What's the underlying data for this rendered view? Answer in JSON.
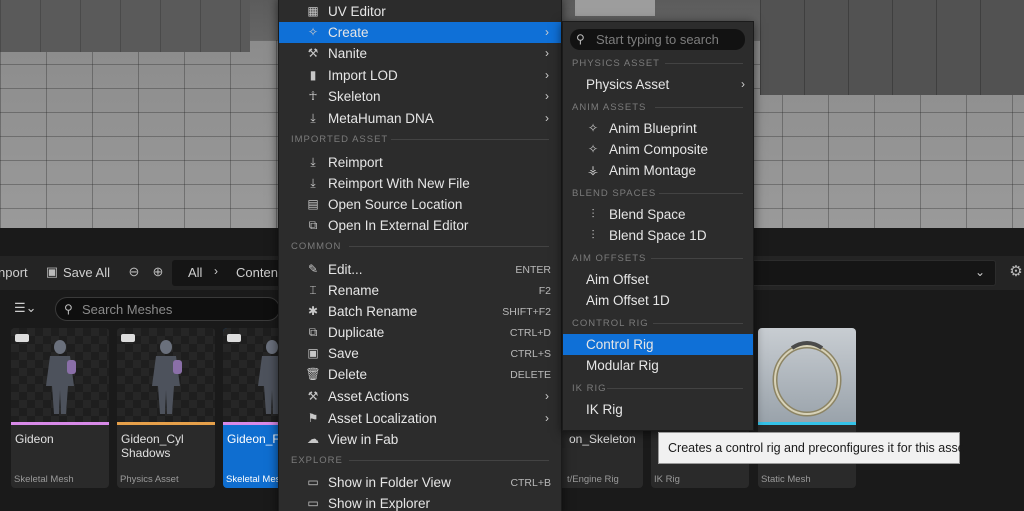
{
  "toolbar": {
    "import_label": "nport",
    "save_all_label": "Save All",
    "path_all": "All",
    "path_content": "Conten"
  },
  "content_browser": {
    "search_placeholder": "Search Meshes",
    "assets": [
      {
        "name": "Gideon",
        "type": "Skeletal Mesh",
        "color": "#d88ae8"
      },
      {
        "name": "Gideon_Cyl Shadows",
        "type": "Physics Asset",
        "color": "#e6a04a"
      },
      {
        "name": "Gideon_Fi",
        "type": "Skeletal Mes",
        "color": "#d88ae8"
      },
      {
        "name": "on_Skeleton",
        "type": "t/Engine Rig",
        "color": ""
      },
      {
        "name": "",
        "type": "IK Rig",
        "color": ""
      },
      {
        "name": "",
        "type": "Static Mesh",
        "color": "#35c2e8"
      }
    ]
  },
  "context_menu": {
    "items": [
      {
        "label": "UV Editor",
        "icon": "uv-editor-icon",
        "shortcut": "",
        "submenu": false
      },
      {
        "label": "Create",
        "icon": "create-icon",
        "shortcut": "",
        "submenu": true
      },
      {
        "label": "Nanite",
        "icon": "wrench-icon",
        "shortcut": "",
        "submenu": true
      },
      {
        "label": "Import LOD",
        "icon": "lod-icon",
        "shortcut": "",
        "submenu": true
      },
      {
        "label": "Skeleton",
        "icon": "skeleton-icon",
        "shortcut": "",
        "submenu": true
      },
      {
        "label": "MetaHuman DNA",
        "icon": "import-icon",
        "shortcut": "",
        "submenu": true
      }
    ],
    "section_imported": "IMPORTED ASSET",
    "imported_items": [
      {
        "label": "Reimport",
        "icon": "reimport-icon"
      },
      {
        "label": "Reimport With New File",
        "icon": "reimport-file-icon"
      },
      {
        "label": "Open Source Location",
        "icon": "folder-open-icon"
      },
      {
        "label": "Open In External Editor",
        "icon": "external-editor-icon"
      }
    ],
    "section_common": "COMMON",
    "common_items": [
      {
        "label": "Edit...",
        "icon": "pencil-icon",
        "shortcut": "ENTER",
        "submenu": false
      },
      {
        "label": "Rename",
        "icon": "rename-icon",
        "shortcut": "F2",
        "submenu": false
      },
      {
        "label": "Batch Rename",
        "icon": "batch-rename-icon",
        "shortcut": "SHIFT+F2",
        "submenu": false
      },
      {
        "label": "Duplicate",
        "icon": "duplicate-icon",
        "shortcut": "CTRL+D",
        "submenu": false
      },
      {
        "label": "Save",
        "icon": "save-icon",
        "shortcut": "CTRL+S",
        "submenu": false
      },
      {
        "label": "Delete",
        "icon": "trash-icon",
        "shortcut": "DELETE",
        "submenu": false
      },
      {
        "label": "Asset Actions",
        "icon": "wrench-icon",
        "shortcut": "",
        "submenu": true
      },
      {
        "label": "Asset Localization",
        "icon": "flag-icon",
        "shortcut": "",
        "submenu": true
      },
      {
        "label": "View in Fab",
        "icon": "fab-icon",
        "shortcut": "",
        "submenu": false
      }
    ],
    "section_explore": "EXPLORE",
    "explore_items": [
      {
        "label": "Show in Folder View",
        "icon": "folder-icon",
        "shortcut": "CTRL+B"
      },
      {
        "label": "Show in Explorer",
        "icon": "explorer-icon",
        "shortcut": ""
      }
    ]
  },
  "create_submenu": {
    "search_placeholder": "Start typing to search",
    "sections": {
      "physics": "PHYSICS ASSET",
      "anim": "ANIM ASSETS",
      "blend": "BLEND SPACES",
      "aim": "AIM OFFSETS",
      "control": "CONTROL RIG",
      "ik": "IK RIG"
    },
    "items": {
      "physics_asset": "Physics Asset",
      "anim_blueprint": "Anim Blueprint",
      "anim_composite": "Anim Composite",
      "anim_montage": "Anim Montage",
      "blend_space": "Blend Space",
      "blend_space_1d": "Blend Space 1D",
      "aim_offset": "Aim Offset",
      "aim_offset_1d": "Aim Offset 1D",
      "control_rig": "Control Rig",
      "modular_rig": "Modular Rig",
      "ik_rig": "IK Rig"
    }
  },
  "tooltip": "Creates a control rig and preconfigures it for this asset",
  "colors": {
    "accent": "#0f70d7",
    "menu_bg": "#2c2c2c"
  }
}
